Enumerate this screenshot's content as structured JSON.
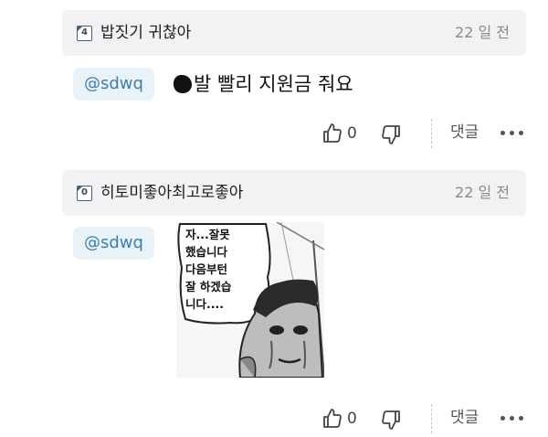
{
  "comments": [
    {
      "level": "4",
      "username": "밥짓기 귀찮아",
      "time": "22 일 전",
      "mention": "@sdwq",
      "text": "발 빨리 지원금 줘요",
      "likes": "0",
      "reply_label": "댓글"
    },
    {
      "level": "0",
      "username": "히토미좋아최고로좋아",
      "time": "22 일 전",
      "mention": "@sdwq",
      "image": {
        "speech_lines": [
          "자...잘못",
          "했습니다",
          "다음부턴",
          "잘 하겠습",
          "니다...."
        ]
      },
      "likes": "0",
      "reply_label": "댓글"
    }
  ],
  "icons": {
    "like": "thumbs-up-icon",
    "dislike": "thumbs-down-icon",
    "more": "more-dots-icon",
    "level": "level-badge-icon"
  },
  "colors": {
    "header_bg": "#f2f2f4",
    "mention_bg": "#e9f2f7",
    "mention_text": "#3a7fb0",
    "time_text": "#8a8a8e"
  }
}
